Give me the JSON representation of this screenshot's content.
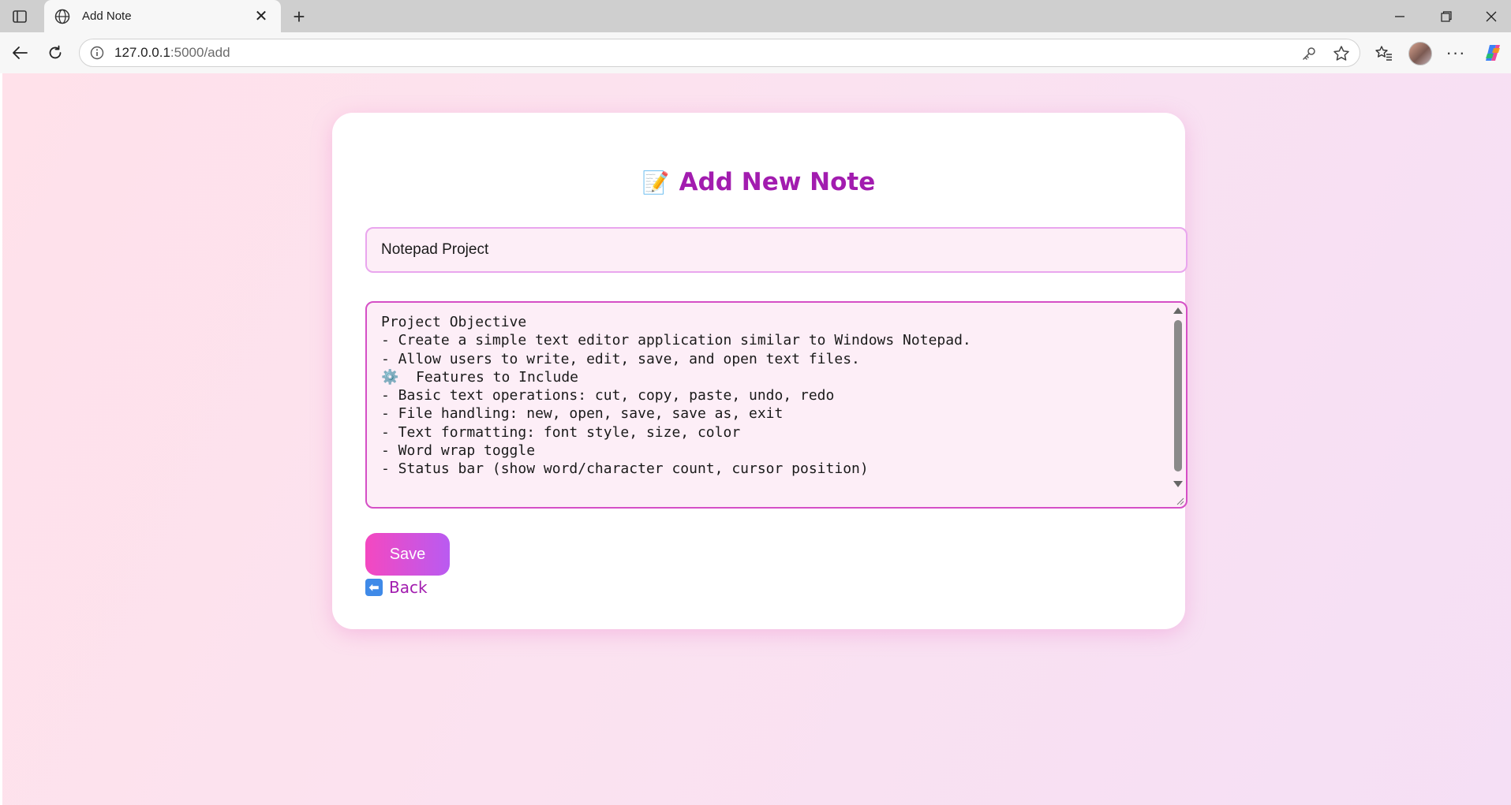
{
  "browser": {
    "tab": {
      "title": "Add Note"
    },
    "address": {
      "host": "127.0.0.1",
      "path": ":5000/add"
    }
  },
  "page": {
    "title_emoji": "📝",
    "title": "Add New Note",
    "title_field": {
      "value": "Notepad Project"
    },
    "content_field": {
      "value": "Project Objective\n- Create a simple text editor application similar to Windows Notepad.\n- Allow users to write, edit, save, and open text files.\n⚙️  Features to Include\n- Basic text operations: cut, copy, paste, undo, redo\n- File handling: new, open, save, save as, exit\n- Text formatting: font style, size, color\n- Word wrap toggle\n- Status bar (show word/character count, cursor position)"
    },
    "save_label": "Save",
    "back_icon": "⬅",
    "back_label": "Back"
  },
  "colors": {
    "accent": "#a21caf",
    "button_start": "#f448c0",
    "button_end": "#b95bf1",
    "field_bg": "#fdeef7"
  }
}
